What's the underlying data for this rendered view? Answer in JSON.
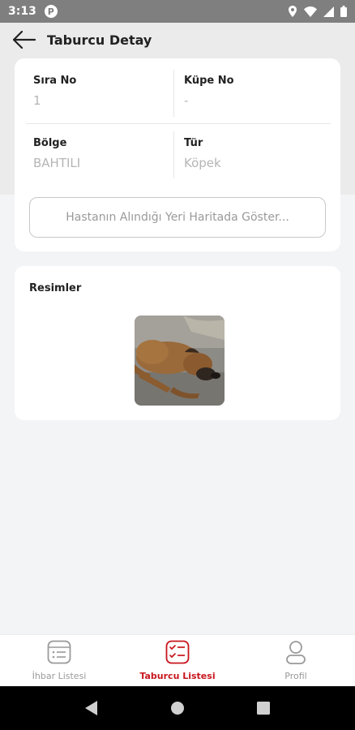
{
  "status_bar": {
    "time": "3:13",
    "app_icon_letter": "P"
  },
  "header": {
    "title": "Taburcu Detay"
  },
  "details": {
    "sira_no_label": "Sıra No",
    "sira_no_value": "1",
    "kupe_no_label": "Küpe No",
    "kupe_no_value": "-",
    "bolge_label": "Bölge",
    "bolge_value": "BAHTILI",
    "tur_label": "Tür",
    "tur_value": "Köpek",
    "map_button_label": "Hastanın Alındığı Yeri Haritada Göster..."
  },
  "images": {
    "title": "Resimler",
    "count": 1
  },
  "bottom_nav": {
    "items": [
      {
        "label": "İhbar Listesi",
        "icon": "list-icon",
        "active": false
      },
      {
        "label": "Taburcu Listesi",
        "icon": "checklist-icon",
        "active": true
      },
      {
        "label": "Profil",
        "icon": "profile-icon",
        "active": false
      }
    ]
  },
  "colors": {
    "accent": "#c8161d",
    "inactive": "#9a9a9a"
  }
}
